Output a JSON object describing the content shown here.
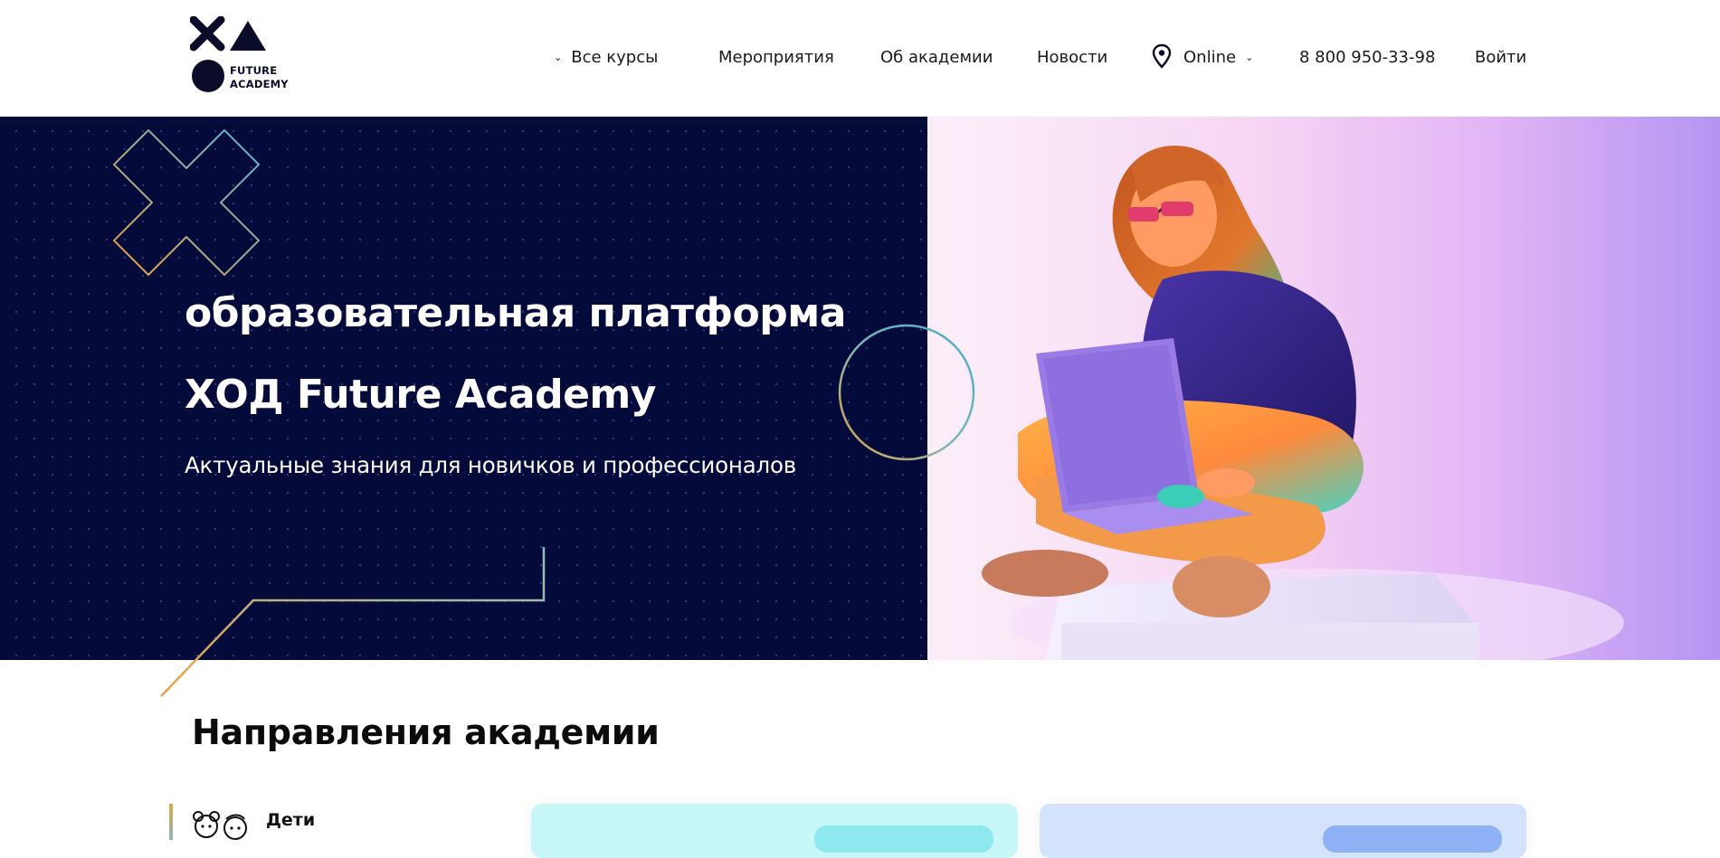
{
  "header": {
    "logo": {
      "line1": "FUTURE",
      "line2": "ACADEMY"
    },
    "nav": {
      "courses": "Все курсы",
      "events": "Мероприятия",
      "about": "Об академии",
      "news": "Новости",
      "location": "Online",
      "phone": "8 800 950-33-98",
      "login": "Войти"
    }
  },
  "hero": {
    "title_line1": "образовательная платформа",
    "title_line2": "ХОД Future Academy",
    "subtitle": "Актуальные знания для новичков и профессионалов"
  },
  "directions": {
    "title": "Направления академии",
    "items": [
      {
        "label": "Дети",
        "icon": "kids-icon"
      }
    ]
  },
  "icons": {
    "courses_dropdown": "chevron-down-icon",
    "location": "map-pin-icon",
    "location_dropdown": "chevron-down-icon"
  },
  "colors": {
    "hero_dark": "#040a3a",
    "brand_navy": "#0b0c2a",
    "accent_orange": "#e2a648",
    "accent_teal": "#5ab4cf",
    "card_cyan": "#c7f7f8",
    "card_blue": "#d3e3fb"
  }
}
